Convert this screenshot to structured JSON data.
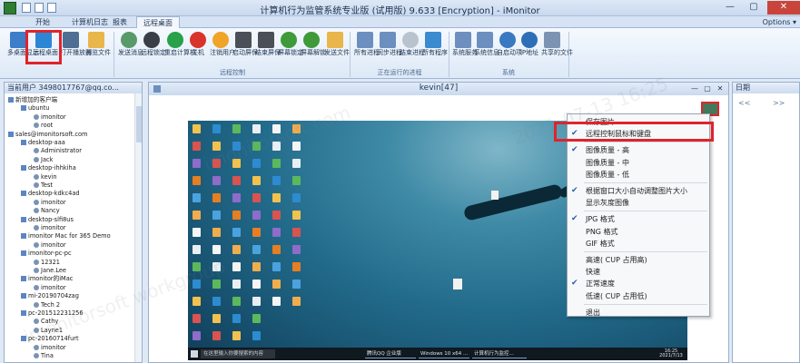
{
  "window": {
    "title": "计算机行为监管系统专业版 (试用版) 9.633 [Encryption] - iMonitor",
    "options_label": "Options ▾"
  },
  "tabs": [
    "开始",
    "计算机日志",
    "报表",
    "远程桌面"
  ],
  "ribbon": {
    "groups": [
      {
        "label": "",
        "buttons": [
          "多桌面显示",
          "远程桌面",
          "打开播放器",
          "浏览文件"
        ]
      },
      {
        "label": "远程控制",
        "buttons": [
          "发送消息",
          "远程锁定",
          "重启计算机",
          "关机",
          "注销用户",
          "启动屏保",
          "结束屏保",
          "屏幕锁定",
          "屏幕解锁",
          "发送文件"
        ]
      },
      {
        "label": "正在运行的进程",
        "buttons": [
          "所有进程",
          "同步进程",
          "结束进程",
          "所有程序"
        ]
      },
      {
        "label": "系统",
        "buttons": [
          "系统服务",
          "系统信息",
          "自启动项",
          "IP地址",
          "共享的文件"
        ]
      }
    ]
  },
  "left_panel": {
    "title": "当前用户 3498017767@qq.co...",
    "tree": [
      {
        "text": "新增加的客户端",
        "level": 1,
        "kind": "group"
      },
      {
        "text": "ubuntu",
        "level": 2,
        "kind": "node"
      },
      {
        "text": "imonitor",
        "level": 3,
        "kind": "user"
      },
      {
        "text": "root",
        "level": 3,
        "kind": "user"
      },
      {
        "text": "sales@imonitorsoft.com",
        "level": 1,
        "kind": "group"
      },
      {
        "text": "desktop-aaa",
        "level": 2,
        "kind": "node"
      },
      {
        "text": "Administrator",
        "level": 3,
        "kind": "user"
      },
      {
        "text": "Jack",
        "level": 3,
        "kind": "user"
      },
      {
        "text": "desktop-ihhkiha",
        "level": 2,
        "kind": "node"
      },
      {
        "text": "kevin",
        "level": 3,
        "kind": "user"
      },
      {
        "text": "Test",
        "level": 3,
        "kind": "user"
      },
      {
        "text": "desktop-kdkc4ad",
        "level": 2,
        "kind": "node"
      },
      {
        "text": "imonitor",
        "level": 3,
        "kind": "user"
      },
      {
        "text": "Nancy",
        "level": 3,
        "kind": "user"
      },
      {
        "text": "desktop-slfi8us",
        "level": 2,
        "kind": "node"
      },
      {
        "text": "imonitor",
        "level": 3,
        "kind": "user"
      },
      {
        "text": "imonitor Mac for 365 Demo",
        "level": 2,
        "kind": "node"
      },
      {
        "text": "imonitor",
        "level": 3,
        "kind": "user"
      },
      {
        "text": "imonitor-pc-pc",
        "level": 2,
        "kind": "node"
      },
      {
        "text": "12321",
        "level": 3,
        "kind": "user"
      },
      {
        "text": "Jane.Lee",
        "level": 3,
        "kind": "user"
      },
      {
        "text": "imonitor的iMac",
        "level": 2,
        "kind": "node"
      },
      {
        "text": "imonitor",
        "level": 3,
        "kind": "user"
      },
      {
        "text": "mi-20190704zag",
        "level": 2,
        "kind": "node"
      },
      {
        "text": "Tech 2",
        "level": 3,
        "kind": "user"
      },
      {
        "text": "pc-201512231256",
        "level": 2,
        "kind": "node"
      },
      {
        "text": "Cathy",
        "level": 3,
        "kind": "user"
      },
      {
        "text": "Layne1",
        "level": 3,
        "kind": "user"
      },
      {
        "text": "pc-20160714furt",
        "level": 2,
        "kind": "node"
      },
      {
        "text": "imonitor",
        "level": 3,
        "kind": "user"
      },
      {
        "text": "Tina",
        "level": 3,
        "kind": "user"
      }
    ]
  },
  "viewer": {
    "title": "kevin[47]",
    "taskbar": {
      "search_placeholder": "在这里输入你要搜索的内容",
      "apps": [
        "腾讯QQ 企业版",
        "Windows 10 x64 ...",
        "计算机行为监控..."
      ],
      "clock_time": "16:25",
      "clock_date": "2021/7/13"
    }
  },
  "context_menu": {
    "items": [
      {
        "label": "保存图片",
        "checked": false
      },
      {
        "label": "远程控制鼠标和键盘",
        "checked": true
      },
      {
        "sep": true
      },
      {
        "label": "图像质量 - 高",
        "checked": true
      },
      {
        "label": "图像质量 - 中",
        "checked": false
      },
      {
        "label": "图像质量 - 低",
        "checked": false
      },
      {
        "sep": true
      },
      {
        "label": "根据窗口大小自动调整图片大小",
        "checked": true
      },
      {
        "label": "显示灰度图像",
        "checked": false
      },
      {
        "sep": true
      },
      {
        "label": "JPG 格式",
        "checked": true
      },
      {
        "label": "PNG 格式",
        "checked": false
      },
      {
        "label": "GIF 格式",
        "checked": false
      },
      {
        "sep": true
      },
      {
        "label": "高速( CUP 占用高)",
        "checked": false
      },
      {
        "label": "快速",
        "checked": false
      },
      {
        "label": "正常速度",
        "checked": true
      },
      {
        "label": "低速( CUP 占用低)",
        "checked": false
      },
      {
        "sep": true
      },
      {
        "label": "退出",
        "checked": false
      }
    ]
  },
  "right_panel": {
    "title": "日期",
    "nav_prev": "<<",
    "nav_next": ">>"
  },
  "colors": {
    "highlight": "#e0232b",
    "check": "#2b5fa5"
  }
}
